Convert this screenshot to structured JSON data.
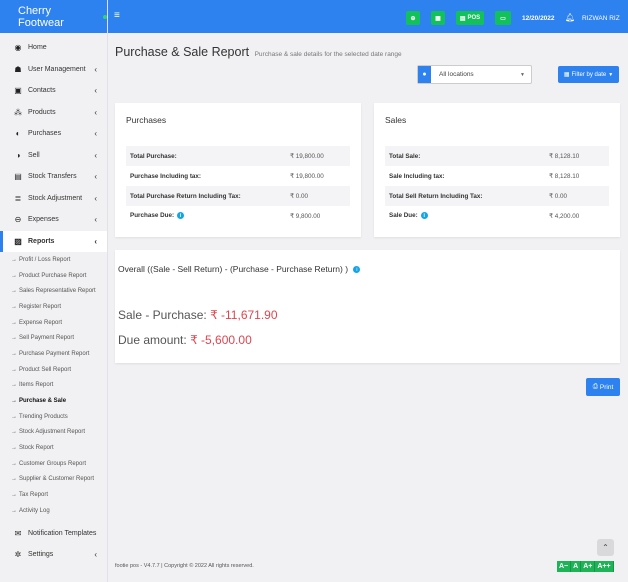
{
  "brand": {
    "name": "Cherry Footwear"
  },
  "topbar": {
    "menu_icon": "hamburger-icon",
    "buttons": [
      {
        "icon": "plus-circle-icon",
        "label": ""
      },
      {
        "icon": "calculator-icon",
        "label": ""
      },
      {
        "icon": "pos-icon",
        "label": "POS"
      },
      {
        "icon": "money-icon",
        "label": ""
      }
    ],
    "date": "12/20/2022",
    "user": "RIZWAN RIZ"
  },
  "sidebar": {
    "items": [
      {
        "label": "Home",
        "icon": "dashboard-icon",
        "glyph": "◉",
        "chevron": false
      },
      {
        "label": "User Management",
        "icon": "users-icon",
        "glyph": "☗",
        "chevron": true
      },
      {
        "label": "Contacts",
        "icon": "address-book-icon",
        "glyph": "▣",
        "chevron": true
      },
      {
        "label": "Products",
        "icon": "cubes-icon",
        "glyph": "⁂",
        "chevron": true
      },
      {
        "label": "Purchases",
        "icon": "arrow-circle-down-icon",
        "glyph": "◐",
        "chevron": true
      },
      {
        "label": "Sell",
        "icon": "arrow-circle-up-icon",
        "glyph": "◑",
        "chevron": true
      },
      {
        "label": "Stock Transfers",
        "icon": "truck-icon",
        "glyph": "▤",
        "chevron": true
      },
      {
        "label": "Stock Adjustment",
        "icon": "database-icon",
        "glyph": "≣",
        "chevron": true
      },
      {
        "label": "Expenses",
        "icon": "minus-circle-icon",
        "glyph": "⊖",
        "chevron": true
      },
      {
        "label": "Reports",
        "icon": "chart-icon",
        "glyph": "▨",
        "chevron": true,
        "active": true
      }
    ],
    "report_items": [
      "Profit / Loss Report",
      "Product Purchase Report",
      "Sales Representative Report",
      "Register Report",
      "Expense Report",
      "Sell Payment Report",
      "Purchase Payment Report",
      "Product Sell Report",
      "Items Report",
      "Purchase & Sale",
      "Trending Products",
      "Stock Adjustment Report",
      "Stock Report",
      "Customer Groups Report",
      "Supplier & Customer Report",
      "Tax Report",
      "Activity Log"
    ],
    "active_report": "Purchase & Sale",
    "bottom_items": [
      {
        "label": "Notification Templates",
        "icon": "envelope-icon",
        "glyph": "✉",
        "chevron": false
      },
      {
        "label": "Settings",
        "icon": "cog-icon",
        "glyph": "✲",
        "chevron": true
      }
    ]
  },
  "page": {
    "title": "Purchase & Sale Report",
    "subtitle": "Purchase & sale details for the selected date range"
  },
  "filters": {
    "location": "All locations",
    "date_button": "Filter by date"
  },
  "purchases": {
    "title": "Purchases",
    "rows": [
      {
        "label": "Total Purchase:",
        "value": "₹ 19,800.00",
        "info": false
      },
      {
        "label": "Purchase Including tax:",
        "value": "₹ 19,800.00",
        "info": false
      },
      {
        "label": "Total Purchase Return Including Tax:",
        "value": "₹ 0.00",
        "info": false
      },
      {
        "label": "Purchase Due:",
        "value": "₹ 9,800.00",
        "info": true
      }
    ]
  },
  "sales": {
    "title": "Sales",
    "rows": [
      {
        "label": "Total Sale:",
        "value": "₹ 8,128.10",
        "info": false
      },
      {
        "label": "Sale Including tax:",
        "value": "₹ 8,128.10",
        "info": false
      },
      {
        "label": "Total Sell Return Including Tax:",
        "value": "₹ 0.00",
        "info": false
      },
      {
        "label": "Sale Due:",
        "value": "₹ 4,200.00",
        "info": true
      }
    ]
  },
  "overall": {
    "title": "Overall ((Sale - Sell Return) - (Purchase - Purchase Return) )",
    "sale_purchase_label": "Sale - Purchase:",
    "sale_purchase_value": "₹ -11,671.90",
    "due_label": "Due amount:",
    "due_value": "₹ -5,600.00"
  },
  "print_label": "Print",
  "footer": "footie pos - V4.7.7 | Copyright © 2022 All rights reserved.",
  "font_controls": [
    "A−",
    "A",
    "A+",
    "A++"
  ],
  "colors": {
    "primary": "#2d82f0",
    "success": "#12c15a",
    "negative": "#e0454f",
    "info": "#14a4e6"
  }
}
